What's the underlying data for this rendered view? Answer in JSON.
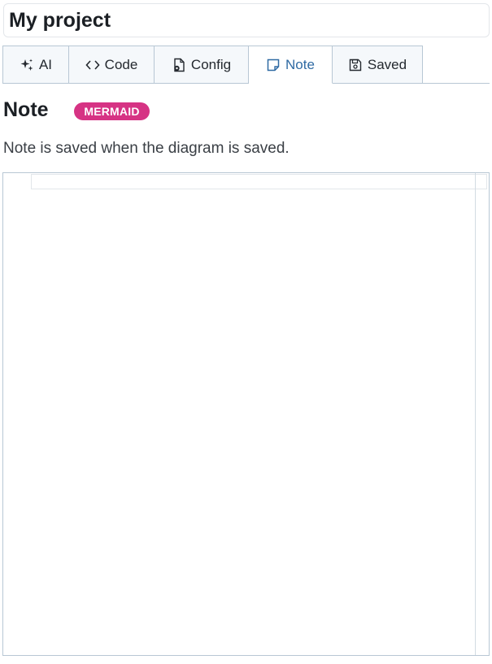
{
  "project": {
    "title": "My project"
  },
  "tabs": [
    {
      "label": "AI",
      "icon": "sparkles-icon"
    },
    {
      "label": "Code",
      "icon": "code-icon"
    },
    {
      "label": "Config",
      "icon": "file-gear-icon"
    },
    {
      "label": "Note",
      "icon": "sticky-note-icon",
      "active": true
    },
    {
      "label": "Saved",
      "icon": "floppy-disk-icon"
    }
  ],
  "note": {
    "heading": "Note",
    "badge": "MERMAID",
    "description": "Note is saved when the diagram is saved.",
    "content": ""
  },
  "colors": {
    "accent": "#2f6aa3",
    "badge": "#d63384",
    "border": "#b8c7d4",
    "tab_bg": "#f5f8fb"
  }
}
